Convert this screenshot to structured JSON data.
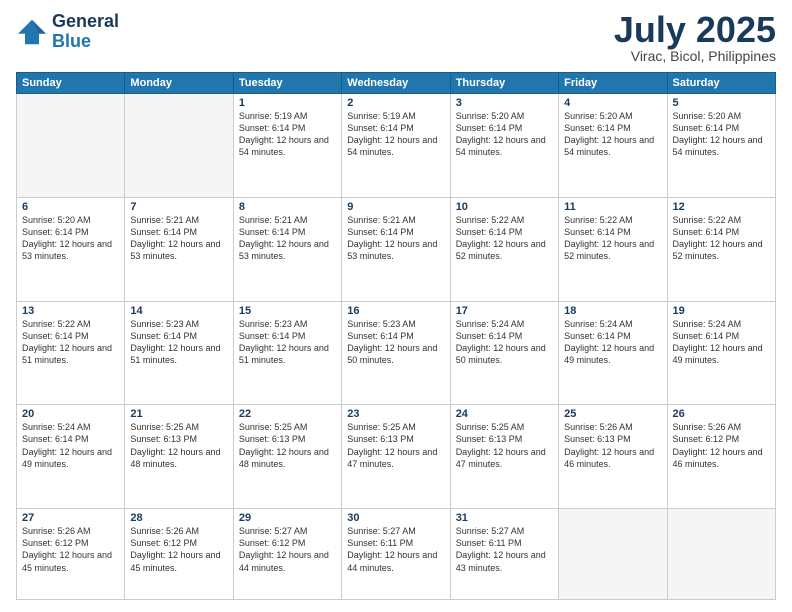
{
  "header": {
    "logo_line1": "General",
    "logo_line2": "Blue",
    "month": "July 2025",
    "location": "Virac, Bicol, Philippines"
  },
  "days_of_week": [
    "Sunday",
    "Monday",
    "Tuesday",
    "Wednesday",
    "Thursday",
    "Friday",
    "Saturday"
  ],
  "weeks": [
    [
      {
        "num": "",
        "info": ""
      },
      {
        "num": "",
        "info": ""
      },
      {
        "num": "1",
        "info": "Sunrise: 5:19 AM\nSunset: 6:14 PM\nDaylight: 12 hours\nand 54 minutes."
      },
      {
        "num": "2",
        "info": "Sunrise: 5:19 AM\nSunset: 6:14 PM\nDaylight: 12 hours\nand 54 minutes."
      },
      {
        "num": "3",
        "info": "Sunrise: 5:20 AM\nSunset: 6:14 PM\nDaylight: 12 hours\nand 54 minutes."
      },
      {
        "num": "4",
        "info": "Sunrise: 5:20 AM\nSunset: 6:14 PM\nDaylight: 12 hours\nand 54 minutes."
      },
      {
        "num": "5",
        "info": "Sunrise: 5:20 AM\nSunset: 6:14 PM\nDaylight: 12 hours\nand 54 minutes."
      }
    ],
    [
      {
        "num": "6",
        "info": "Sunrise: 5:20 AM\nSunset: 6:14 PM\nDaylight: 12 hours\nand 53 minutes."
      },
      {
        "num": "7",
        "info": "Sunrise: 5:21 AM\nSunset: 6:14 PM\nDaylight: 12 hours\nand 53 minutes."
      },
      {
        "num": "8",
        "info": "Sunrise: 5:21 AM\nSunset: 6:14 PM\nDaylight: 12 hours\nand 53 minutes."
      },
      {
        "num": "9",
        "info": "Sunrise: 5:21 AM\nSunset: 6:14 PM\nDaylight: 12 hours\nand 53 minutes."
      },
      {
        "num": "10",
        "info": "Sunrise: 5:22 AM\nSunset: 6:14 PM\nDaylight: 12 hours\nand 52 minutes."
      },
      {
        "num": "11",
        "info": "Sunrise: 5:22 AM\nSunset: 6:14 PM\nDaylight: 12 hours\nand 52 minutes."
      },
      {
        "num": "12",
        "info": "Sunrise: 5:22 AM\nSunset: 6:14 PM\nDaylight: 12 hours\nand 52 minutes."
      }
    ],
    [
      {
        "num": "13",
        "info": "Sunrise: 5:22 AM\nSunset: 6:14 PM\nDaylight: 12 hours\nand 51 minutes."
      },
      {
        "num": "14",
        "info": "Sunrise: 5:23 AM\nSunset: 6:14 PM\nDaylight: 12 hours\nand 51 minutes."
      },
      {
        "num": "15",
        "info": "Sunrise: 5:23 AM\nSunset: 6:14 PM\nDaylight: 12 hours\nand 51 minutes."
      },
      {
        "num": "16",
        "info": "Sunrise: 5:23 AM\nSunset: 6:14 PM\nDaylight: 12 hours\nand 50 minutes."
      },
      {
        "num": "17",
        "info": "Sunrise: 5:24 AM\nSunset: 6:14 PM\nDaylight: 12 hours\nand 50 minutes."
      },
      {
        "num": "18",
        "info": "Sunrise: 5:24 AM\nSunset: 6:14 PM\nDaylight: 12 hours\nand 49 minutes."
      },
      {
        "num": "19",
        "info": "Sunrise: 5:24 AM\nSunset: 6:14 PM\nDaylight: 12 hours\nand 49 minutes."
      }
    ],
    [
      {
        "num": "20",
        "info": "Sunrise: 5:24 AM\nSunset: 6:14 PM\nDaylight: 12 hours\nand 49 minutes."
      },
      {
        "num": "21",
        "info": "Sunrise: 5:25 AM\nSunset: 6:13 PM\nDaylight: 12 hours\nand 48 minutes."
      },
      {
        "num": "22",
        "info": "Sunrise: 5:25 AM\nSunset: 6:13 PM\nDaylight: 12 hours\nand 48 minutes."
      },
      {
        "num": "23",
        "info": "Sunrise: 5:25 AM\nSunset: 6:13 PM\nDaylight: 12 hours\nand 47 minutes."
      },
      {
        "num": "24",
        "info": "Sunrise: 5:25 AM\nSunset: 6:13 PM\nDaylight: 12 hours\nand 47 minutes."
      },
      {
        "num": "25",
        "info": "Sunrise: 5:26 AM\nSunset: 6:13 PM\nDaylight: 12 hours\nand 46 minutes."
      },
      {
        "num": "26",
        "info": "Sunrise: 5:26 AM\nSunset: 6:12 PM\nDaylight: 12 hours\nand 46 minutes."
      }
    ],
    [
      {
        "num": "27",
        "info": "Sunrise: 5:26 AM\nSunset: 6:12 PM\nDaylight: 12 hours\nand 45 minutes."
      },
      {
        "num": "28",
        "info": "Sunrise: 5:26 AM\nSunset: 6:12 PM\nDaylight: 12 hours\nand 45 minutes."
      },
      {
        "num": "29",
        "info": "Sunrise: 5:27 AM\nSunset: 6:12 PM\nDaylight: 12 hours\nand 44 minutes."
      },
      {
        "num": "30",
        "info": "Sunrise: 5:27 AM\nSunset: 6:11 PM\nDaylight: 12 hours\nand 44 minutes."
      },
      {
        "num": "31",
        "info": "Sunrise: 5:27 AM\nSunset: 6:11 PM\nDaylight: 12 hours\nand 43 minutes."
      },
      {
        "num": "",
        "info": ""
      },
      {
        "num": "",
        "info": ""
      }
    ]
  ]
}
